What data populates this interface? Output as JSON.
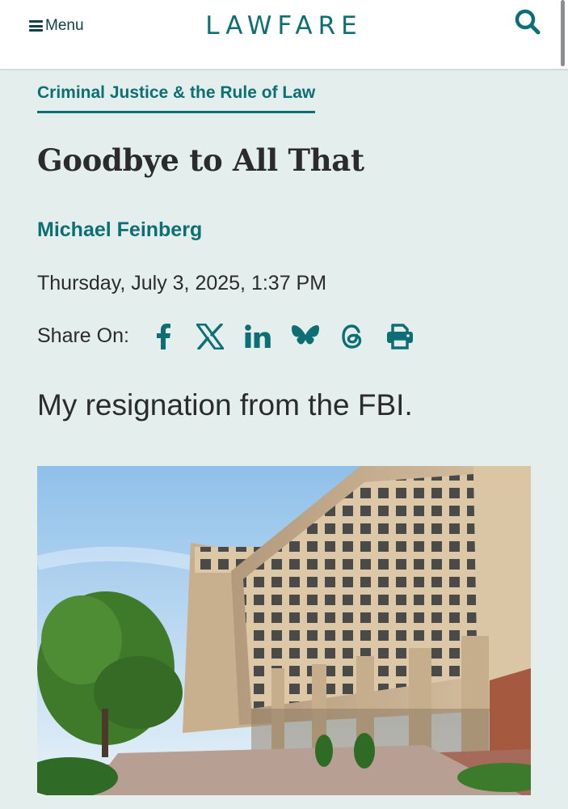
{
  "header": {
    "menu_label": "Menu",
    "logo_text": "LAWFARE",
    "search_icon": "search-icon",
    "menu_icon": "hamburger-icon"
  },
  "article": {
    "category": "Criminal Justice & the Rule of Law",
    "title": "Goodbye to All That",
    "author": "Michael Feinberg",
    "date": "Thursday, July 3, 2025, 1:37 PM",
    "subtitle": "My resignation from the FBI."
  },
  "share": {
    "label": "Share On:",
    "icons": [
      "facebook-icon",
      "x-icon",
      "linkedin-icon",
      "bluesky-icon",
      "threads-icon",
      "print-icon"
    ]
  },
  "colors": {
    "accent": "#0d6f73",
    "page_background": "#e3eeed",
    "text": "#2b2b2b"
  }
}
